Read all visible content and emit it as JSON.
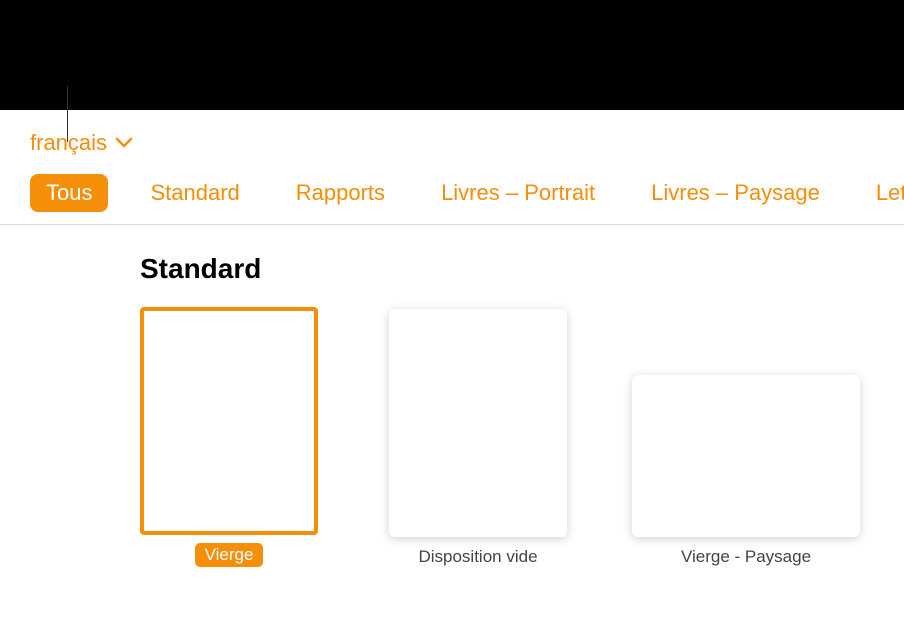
{
  "colors": {
    "accent": "#f58e08"
  },
  "language": {
    "label": "français"
  },
  "tabs": [
    {
      "label": "Tous",
      "selected": true
    },
    {
      "label": "Standard",
      "selected": false
    },
    {
      "label": "Rapports",
      "selected": false
    },
    {
      "label": "Livres – Portrait",
      "selected": false
    },
    {
      "label": "Livres – Paysage",
      "selected": false
    },
    {
      "label": "Lett",
      "selected": false
    }
  ],
  "section": {
    "title": "Standard",
    "templates": [
      {
        "label": "Vierge",
        "orientation": "portrait",
        "selected": true
      },
      {
        "label": "Disposition vide",
        "orientation": "portrait",
        "selected": false
      },
      {
        "label": "Vierge - Paysage",
        "orientation": "landscape",
        "selected": false
      }
    ]
  }
}
